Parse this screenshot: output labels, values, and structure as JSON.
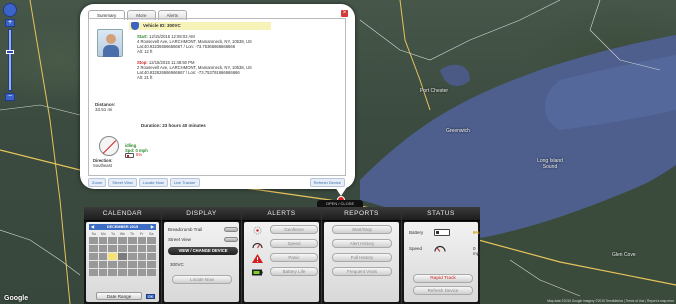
{
  "popup": {
    "tabs": [
      "Summary",
      "More",
      "Alerts"
    ],
    "close_icon": "close-icon",
    "vehicle_id": "Vehicle ID: 300VC",
    "start": {
      "label": "Start:",
      "time": "12/15/2015 12:08:02 AM",
      "address": "4 Roosevelt Ave, LARCHMONT, Mamaroneck, NY, 10538, US",
      "latlon": "Lat:40.93236666666667 / Lon: -73.75366666666666",
      "alt": "Alt: 12 ft"
    },
    "stop": {
      "label": "Stop:",
      "time": "12/15/2015 11:48:50 PM",
      "address": "2 Roosevelt Ave, LARCHMONT, Mamaroneck, NY, 10538, US",
      "latlon": "Lat:40.932626666666667 / Lon: -73.753791666666666",
      "alt": "Alt: 21 ft"
    },
    "distance_label": "Distance:",
    "distance_value": "33.51 mi",
    "duration": "Duration: 23 hours 40 minutes",
    "speed_status": "idling",
    "speed_value": "Spd: 0 mph",
    "battery_pct": "6%",
    "direction_label": "Direction:",
    "direction_value": "Southeast",
    "links": [
      "Zoom",
      "Street View",
      "Locate Now",
      "Live Tracker"
    ],
    "refresh": "Refresh Device"
  },
  "open_close": "OPEN / CLOSE",
  "dock": {
    "calendar": {
      "header": "CALENDAR",
      "month": "DECEMBER 2015",
      "days": [
        "Su",
        "Mo",
        "Tu",
        "We",
        "Th",
        "Fr",
        "Sa"
      ],
      "date_range": "Date Range",
      "ok": "OK"
    },
    "display": {
      "header": "DISPLAY",
      "breadcrumb": "Breadcrumb Trail",
      "street": "Street View",
      "view_change": "VIEW / CHANGE DEVICE",
      "device": "300VC",
      "locate": "Locate Now"
    },
    "alerts": {
      "header": "ALERTS",
      "geofence": "Geofence",
      "speed": "Speed",
      "panic": "Panic",
      "battery": "Battery Life"
    },
    "reports": {
      "header": "REPORTS",
      "items": [
        "Start/Stop",
        "Alert History",
        "Full History",
        "Frequent Visits"
      ]
    },
    "status": {
      "header": "STATUS",
      "battery_label": "Battery",
      "battery_value": "6%",
      "speed_label": "Speed",
      "speed_value": "0 mph",
      "rapid_track": "Rapid Track",
      "refresh": "Refresh Device"
    }
  },
  "map": {
    "labels": [
      "Port Chester",
      "Long Island Sound",
      "Greenwich",
      "Glen Cove"
    ],
    "google": "Google",
    "copyright": "Map data ©2015 Google Imagery ©2015 TerraMetrics | Terms of Use | Report a map error"
  },
  "colors": {
    "water": "#4e5f8e",
    "accent_blue": "#3d6cc4",
    "alert_red": "#c22222",
    "start_green": "#2b8a2b"
  }
}
